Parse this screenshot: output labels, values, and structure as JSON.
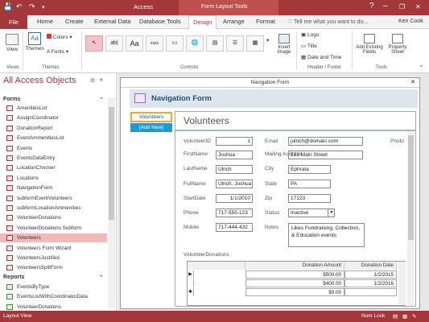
{
  "title_bar": {
    "app_title": "Access",
    "context_tab_group": "Form Layout Tools",
    "minimize": "–",
    "restore": "❐",
    "close": "✕",
    "help": "?"
  },
  "tabs": {
    "file": "File",
    "home": "Home",
    "create": "Create",
    "external_data": "External Data",
    "database_tools": "Database Tools",
    "design": "Design",
    "arrange": "Arrange",
    "format": "Format",
    "tell_me": "Tell me what you want to do...",
    "user": "Ken Cook"
  },
  "ribbon": {
    "view": "View",
    "themes": "Themes",
    "colors": "Colors",
    "fonts": "Fonts",
    "insert_image": "Insert Image",
    "logo": "Logo",
    "title": "Title",
    "date_time": "Date and Time",
    "add_existing_fields": "Add Existing Fields",
    "property_sheet": "Property Sheet",
    "group_views": "Views",
    "group_themes": "Themes",
    "group_controls": "Controls",
    "group_header_footer": "Header / Footer",
    "group_tools": "Tools",
    "ctrl_label": "ab|",
    "ctrl_aa": "Aa",
    "ctrl_xxxx": "xxxx"
  },
  "nav_pane": {
    "header": "All Access Objects",
    "forms_section": "Forms",
    "reports_section": "Reports",
    "forms": [
      "AmenitiesList",
      "AssignCoordinator",
      "DonationReport",
      "EventAmmenitiesList",
      "Events",
      "EventsDataEntry",
      "LocationChooser",
      "Locations",
      "NavigationForm",
      "subformEventVolunteers",
      "subformLocationAmmenities",
      "VolunteerDonations",
      "VolunteerDonations Subform",
      "Volunteers",
      "Volunteers Form Wizard",
      "VolunteersJustified",
      "VolunteersSplitForm"
    ],
    "reports": [
      "EventsByType",
      "EventsListWithCoordinatorData",
      "VolunteerDonations"
    ]
  },
  "form": {
    "window_title": "Navigation Form",
    "header": "Navigation Form",
    "nav_tab_volunteers": "Volunteers",
    "nav_tab_add_new": "[Add New]",
    "subform_title": "Volunteers",
    "labels": {
      "volunteer_id": "VolunteerID",
      "first_name": "FirstName",
      "last_name": "LastName",
      "full_name": "FullName",
      "start_date": "StartDate",
      "phone": "Phone",
      "mobile": "Mobile",
      "email": "Email",
      "mailing_address": "Mailing Address",
      "city": "City",
      "state": "State",
      "zip": "Zip",
      "status": "Status",
      "notes": "Notes",
      "photo": "Photo",
      "volunteer_donations": "VolunteerDonations"
    },
    "values": {
      "volunteer_id": "1",
      "first_name": "Joshua",
      "last_name": "Ulrich",
      "full_name": "Ulrich, Joshua",
      "start_date": "1/1/2010",
      "phone": "717-555-123",
      "mobile": "717-444-432",
      "email": "julrich@domain.com",
      "mailing_address": "123 Main Street",
      "city": "Ephrata",
      "state": "PA",
      "zip": "17123",
      "status": "Inactive",
      "notes": "Likes Fundraising, Collection, & Education events"
    },
    "donations": {
      "col_amount": "Donation Amount",
      "col_date": "Donation Date",
      "rows": [
        {
          "selector": "▶",
          "amount": "$500.00",
          "date": "1/2/2015"
        },
        {
          "selector": "",
          "amount": "$400.00",
          "date": "1/2/2016"
        },
        {
          "selector": "✱",
          "amount": "$0.00",
          "date": ""
        }
      ]
    }
  },
  "status_bar": {
    "left": "Layout View",
    "num_lock": "Num Lock"
  }
}
